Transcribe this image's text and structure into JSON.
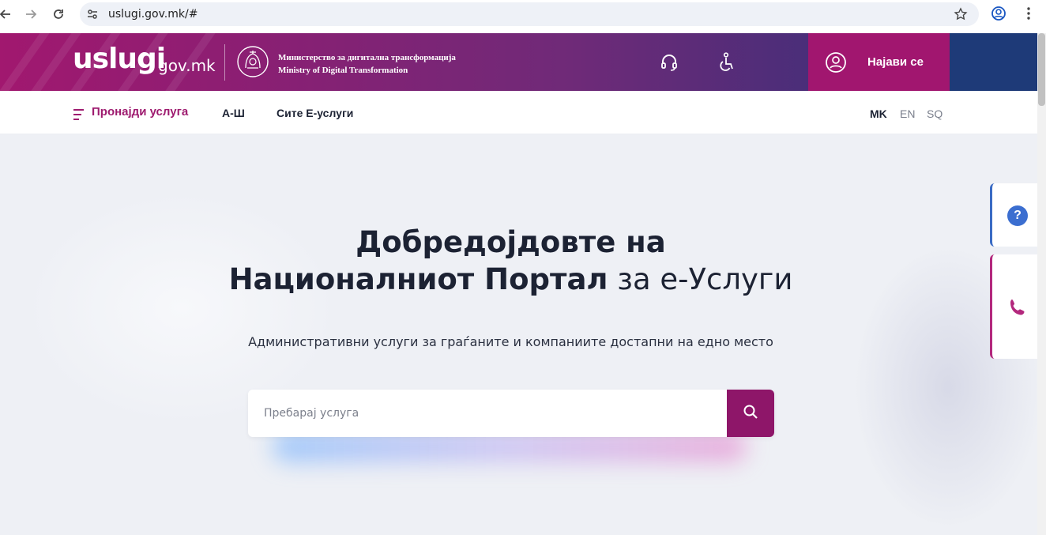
{
  "browser": {
    "url": "uslugi.gov.mk/#"
  },
  "header": {
    "logo_main": "uslugi",
    "logo_domain": "gov.mk",
    "ministry_mk": "Министерство за дигитална трансформација",
    "ministry_en": "Ministry of Digital Transformation",
    "login_label": "Најави се"
  },
  "nav": {
    "find_service": "Пронајди услуга",
    "a_z": "А-Ш",
    "all_eservices": "Сите Е-услуги",
    "languages": [
      "MK",
      "EN",
      "SQ"
    ],
    "active_language": "MK"
  },
  "hero": {
    "title_line1": "Добредојдовте на",
    "title_line2_bold": "Националниот Портал",
    "title_line2_rest": " за е-Услуги",
    "subtitle": "Административни услуги за граѓаните и компаниите достапни на едно место",
    "search_placeholder": "Пребарај услуга"
  },
  "floating": {
    "help_symbol": "?"
  },
  "colors": {
    "brand_magenta": "#a1166f",
    "brand_navy": "#1e3a78",
    "text_dark": "#1c2233"
  },
  "icons": [
    "back-icon",
    "forward-icon",
    "reload-icon",
    "site-settings-icon",
    "bookmark-star-icon",
    "profile-icon",
    "chrome-menu-icon",
    "coat-of-arms-icon",
    "headset-icon",
    "accessibility-icon",
    "user-circle-icon",
    "menu-lines-icon",
    "search-icon",
    "help-icon",
    "phone-icon"
  ]
}
